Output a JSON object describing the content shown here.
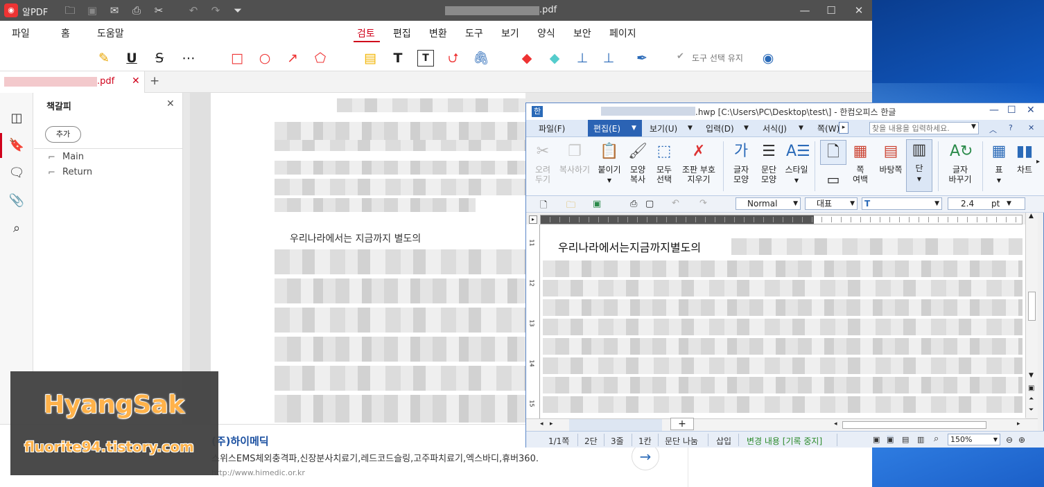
{
  "pdf_app": {
    "app_name": "알PDF",
    "window_title": ".pdf",
    "menu": [
      "파일",
      "홈",
      "도움말",
      "검토",
      "편집",
      "변환",
      "도구",
      "보기",
      "양식",
      "보안",
      "페이지"
    ],
    "active_menu": "검토",
    "keep_tool_label": "도구 선택 유지",
    "tab_title": ".pdf",
    "tab_add": "+",
    "bookmark_panel": {
      "title": "책갈피",
      "add_label": "추가",
      "items": [
        "Main",
        "Return"
      ]
    },
    "doc_text": "우리나라에서는 지금까지 별도의",
    "ad": {
      "company": "(주)하이메딕",
      "desc": "스위스EMS체외충격파,신장분사치료기,레드코드슬링,고주파치료기,엑스바디,휴버360.",
      "url": "http://www.himedic.or.kr"
    }
  },
  "watermark": {
    "name": "HyangSak",
    "site": "fluorite94.tistory.com"
  },
  "hwp_app": {
    "title": ".hwp [C:\\Users\\PC\\Desktop\\test\\] - 한컴오피스 한글",
    "menu": [
      "파일(F)",
      "편집(E)",
      "보기(U)",
      "입력(D)",
      "서식(J)",
      "쪽(W)"
    ],
    "active_menu": "편집(E)",
    "search_placeholder": "찾을 내용을 입력하세요.",
    "ribbon": [
      {
        "label1": "오려",
        "label2": "두기",
        "disabled": true
      },
      {
        "label1": "복사하기",
        "label2": "",
        "disabled": true
      },
      {
        "label1": "붙이기",
        "label2": "",
        "disabled": false
      },
      {
        "label1": "모양",
        "label2": "복사",
        "disabled": false
      },
      {
        "label1": "모두",
        "label2": "선택",
        "disabled": false
      },
      {
        "label1": "조판 부호",
        "label2": "지우기",
        "disabled": false
      },
      {
        "label1": "글자",
        "label2": "모양",
        "disabled": false
      },
      {
        "label1": "문단",
        "label2": "모양",
        "disabled": false
      },
      {
        "label1": "스타일",
        "label2": "",
        "disabled": false
      },
      {
        "label1": "쪽",
        "label2": "여백",
        "disabled": false
      },
      {
        "label1": "바탕쪽",
        "label2": "",
        "disabled": false
      },
      {
        "label1": "단",
        "label2": "",
        "disabled": false
      },
      {
        "label1": "글자",
        "label2": "바꾸기",
        "disabled": false
      },
      {
        "label1": "표",
        "label2": "",
        "disabled": false
      },
      {
        "label1": "차트",
        "label2": "",
        "disabled": false
      }
    ],
    "style_value": "Normal",
    "font_lang": "대표",
    "font_name": "",
    "font_size": "2.4",
    "font_unit": "pt",
    "doc_text": "우리나라에서는지금까지별도의",
    "ruler_numbers": [
      "11",
      "12",
      "13",
      "14",
      "15"
    ],
    "status": {
      "page": "1/1쪽",
      "dan": "2단",
      "line": "3줄",
      "col": "1칸",
      "break": "문단 나눔",
      "mode": "삽입",
      "track": "변경 내용 [기록 중지]",
      "zoom": "150%"
    }
  }
}
